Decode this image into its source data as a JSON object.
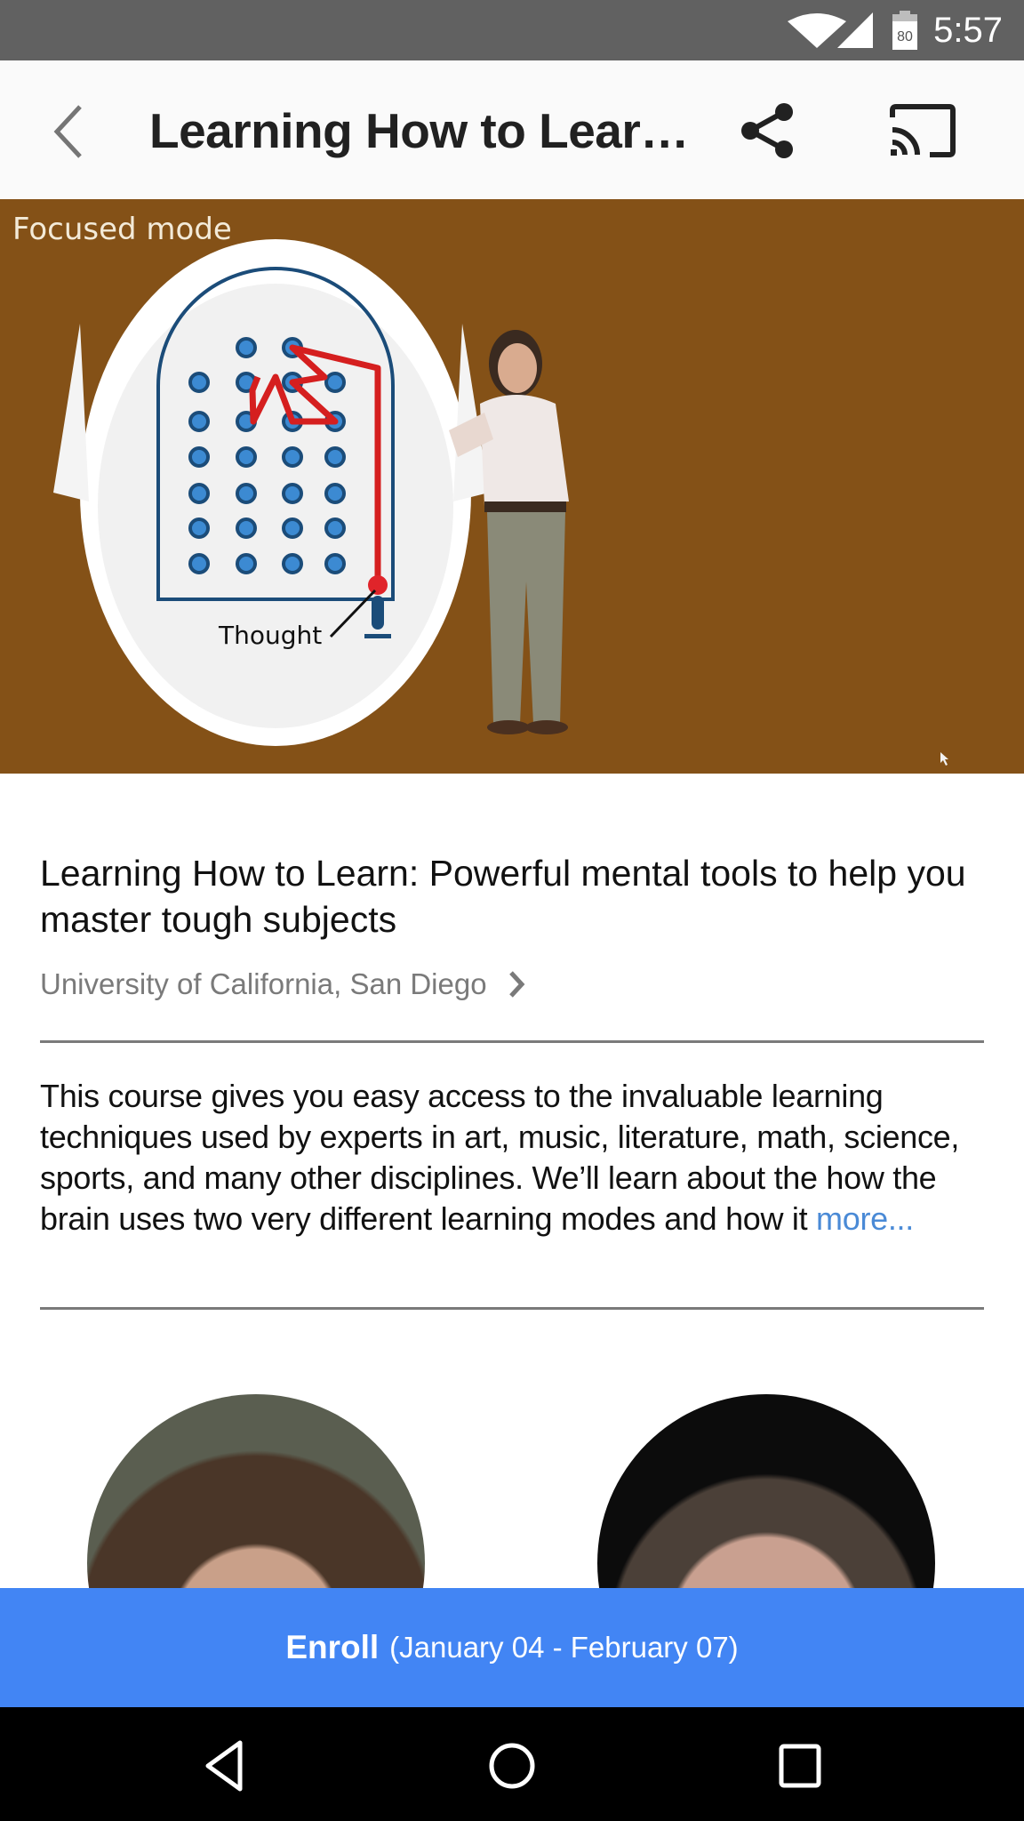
{
  "status_bar": {
    "time": "5:57",
    "battery_level": "80",
    "icons": [
      "wifi-icon",
      "cellular-signal-icon",
      "battery-icon"
    ]
  },
  "app_bar": {
    "title": "Learning How to Learn...",
    "icons": [
      "back-arrow-icon",
      "share-icon",
      "cast-icon"
    ]
  },
  "video": {
    "caption": "Focused mode",
    "diagram_label": "Thought"
  },
  "course": {
    "title": "Learning How to Learn: Powerful mental tools to help you master tough subjects",
    "institution": "University of California, San Diego",
    "description": "This course gives you easy access to the invaluable learning techniques used by experts in art, music, literature, math, science, sports, and many other disciplines. We’ll learn about the how the brain uses two very different learning modes and how it ",
    "more_link": "more..."
  },
  "instructors": [
    {
      "photo": "instructor-1-photo"
    },
    {
      "photo": "instructor-2-photo"
    }
  ],
  "enroll": {
    "label": "Enroll",
    "dates": "(January 04 - February 07)",
    "color": "#4285f4"
  },
  "nav_bar": {
    "buttons": [
      "back-icon",
      "home-icon",
      "recents-icon"
    ]
  }
}
